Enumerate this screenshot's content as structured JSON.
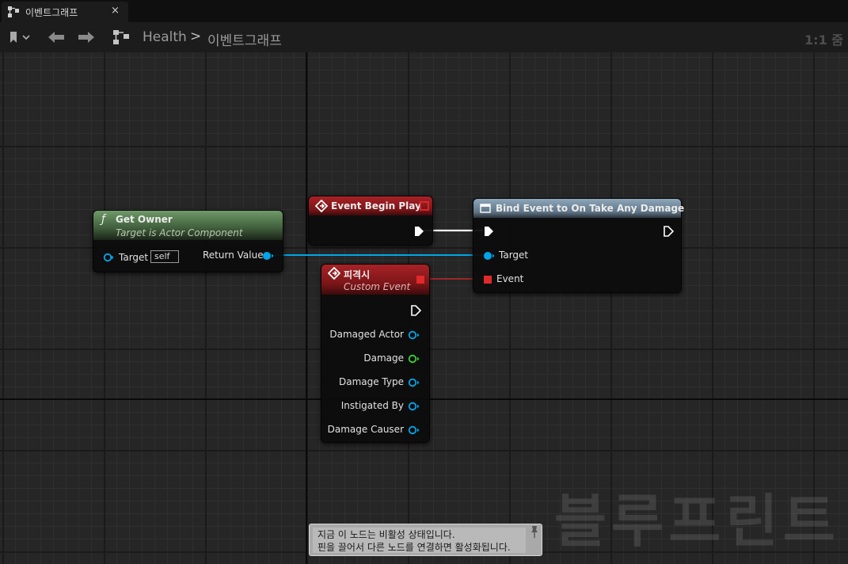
{
  "tab": {
    "label": "이벤트그래프",
    "close_label": "×"
  },
  "breadcrumb": {
    "root": "Health",
    "separator": ">",
    "current": "이벤트그래프"
  },
  "zoom": "1:1 줌",
  "nodes": {
    "get_owner": {
      "title": "Get Owner",
      "subtitle": "Target is Actor Component",
      "target_label": "Target",
      "target_value": "self",
      "return_label": "Return Value",
      "function_glyph": "ƒ",
      "header_color": "#5f8a58"
    },
    "event_begin_play": {
      "title": "Event Begin Play",
      "header_color": "#8f1b1e"
    },
    "bind_event": {
      "title": "Bind Event to On Take Any Damage",
      "target_label": "Target",
      "event_label": "Event",
      "header_color": "#7f98ac"
    },
    "custom_event": {
      "title": "피격시",
      "subtitle": "Custom Event",
      "pins": [
        "Damaged Actor",
        "Damage",
        "Damage Type",
        "Instigated By",
        "Damage Causer"
      ],
      "header_color": "#8f1b1e"
    }
  },
  "pin_colors": {
    "object": "#00a6ea",
    "float": "#38d431",
    "delegate": "#e0292b",
    "exec": "#ffffff"
  },
  "tooltip": {
    "line1": "지금 이 노드는 비활성 상태입니다.",
    "line2": "핀을 끌어서 다른 노드를 연결하면 활성화됩니다."
  },
  "watermark": "블루프린트"
}
